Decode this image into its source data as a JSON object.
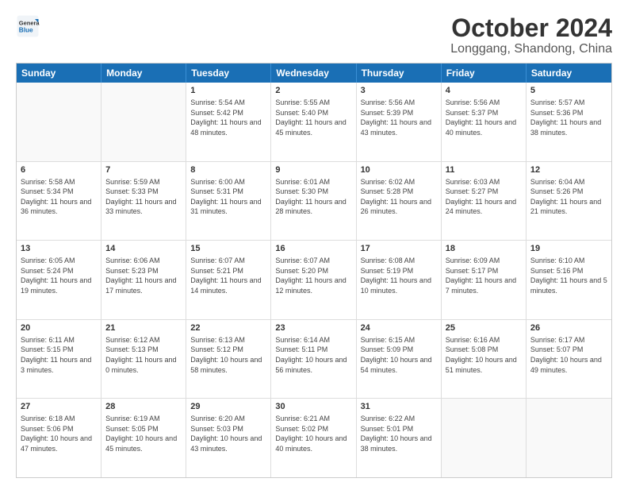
{
  "logo": {
    "line1": "General",
    "line2": "Blue"
  },
  "header": {
    "month": "October 2024",
    "location": "Longgang, Shandong, China"
  },
  "days_of_week": [
    "Sunday",
    "Monday",
    "Tuesday",
    "Wednesday",
    "Thursday",
    "Friday",
    "Saturday"
  ],
  "weeks": [
    [
      {
        "day": "",
        "info": ""
      },
      {
        "day": "",
        "info": ""
      },
      {
        "day": "1",
        "info": "Sunrise: 5:54 AM\nSunset: 5:42 PM\nDaylight: 11 hours and 48 minutes."
      },
      {
        "day": "2",
        "info": "Sunrise: 5:55 AM\nSunset: 5:40 PM\nDaylight: 11 hours and 45 minutes."
      },
      {
        "day": "3",
        "info": "Sunrise: 5:56 AM\nSunset: 5:39 PM\nDaylight: 11 hours and 43 minutes."
      },
      {
        "day": "4",
        "info": "Sunrise: 5:56 AM\nSunset: 5:37 PM\nDaylight: 11 hours and 40 minutes."
      },
      {
        "day": "5",
        "info": "Sunrise: 5:57 AM\nSunset: 5:36 PM\nDaylight: 11 hours and 38 minutes."
      }
    ],
    [
      {
        "day": "6",
        "info": "Sunrise: 5:58 AM\nSunset: 5:34 PM\nDaylight: 11 hours and 36 minutes."
      },
      {
        "day": "7",
        "info": "Sunrise: 5:59 AM\nSunset: 5:33 PM\nDaylight: 11 hours and 33 minutes."
      },
      {
        "day": "8",
        "info": "Sunrise: 6:00 AM\nSunset: 5:31 PM\nDaylight: 11 hours and 31 minutes."
      },
      {
        "day": "9",
        "info": "Sunrise: 6:01 AM\nSunset: 5:30 PM\nDaylight: 11 hours and 28 minutes."
      },
      {
        "day": "10",
        "info": "Sunrise: 6:02 AM\nSunset: 5:28 PM\nDaylight: 11 hours and 26 minutes."
      },
      {
        "day": "11",
        "info": "Sunrise: 6:03 AM\nSunset: 5:27 PM\nDaylight: 11 hours and 24 minutes."
      },
      {
        "day": "12",
        "info": "Sunrise: 6:04 AM\nSunset: 5:26 PM\nDaylight: 11 hours and 21 minutes."
      }
    ],
    [
      {
        "day": "13",
        "info": "Sunrise: 6:05 AM\nSunset: 5:24 PM\nDaylight: 11 hours and 19 minutes."
      },
      {
        "day": "14",
        "info": "Sunrise: 6:06 AM\nSunset: 5:23 PM\nDaylight: 11 hours and 17 minutes."
      },
      {
        "day": "15",
        "info": "Sunrise: 6:07 AM\nSunset: 5:21 PM\nDaylight: 11 hours and 14 minutes."
      },
      {
        "day": "16",
        "info": "Sunrise: 6:07 AM\nSunset: 5:20 PM\nDaylight: 11 hours and 12 minutes."
      },
      {
        "day": "17",
        "info": "Sunrise: 6:08 AM\nSunset: 5:19 PM\nDaylight: 11 hours and 10 minutes."
      },
      {
        "day": "18",
        "info": "Sunrise: 6:09 AM\nSunset: 5:17 PM\nDaylight: 11 hours and 7 minutes."
      },
      {
        "day": "19",
        "info": "Sunrise: 6:10 AM\nSunset: 5:16 PM\nDaylight: 11 hours and 5 minutes."
      }
    ],
    [
      {
        "day": "20",
        "info": "Sunrise: 6:11 AM\nSunset: 5:15 PM\nDaylight: 11 hours and 3 minutes."
      },
      {
        "day": "21",
        "info": "Sunrise: 6:12 AM\nSunset: 5:13 PM\nDaylight: 11 hours and 0 minutes."
      },
      {
        "day": "22",
        "info": "Sunrise: 6:13 AM\nSunset: 5:12 PM\nDaylight: 10 hours and 58 minutes."
      },
      {
        "day": "23",
        "info": "Sunrise: 6:14 AM\nSunset: 5:11 PM\nDaylight: 10 hours and 56 minutes."
      },
      {
        "day": "24",
        "info": "Sunrise: 6:15 AM\nSunset: 5:09 PM\nDaylight: 10 hours and 54 minutes."
      },
      {
        "day": "25",
        "info": "Sunrise: 6:16 AM\nSunset: 5:08 PM\nDaylight: 10 hours and 51 minutes."
      },
      {
        "day": "26",
        "info": "Sunrise: 6:17 AM\nSunset: 5:07 PM\nDaylight: 10 hours and 49 minutes."
      }
    ],
    [
      {
        "day": "27",
        "info": "Sunrise: 6:18 AM\nSunset: 5:06 PM\nDaylight: 10 hours and 47 minutes."
      },
      {
        "day": "28",
        "info": "Sunrise: 6:19 AM\nSunset: 5:05 PM\nDaylight: 10 hours and 45 minutes."
      },
      {
        "day": "29",
        "info": "Sunrise: 6:20 AM\nSunset: 5:03 PM\nDaylight: 10 hours and 43 minutes."
      },
      {
        "day": "30",
        "info": "Sunrise: 6:21 AM\nSunset: 5:02 PM\nDaylight: 10 hours and 40 minutes."
      },
      {
        "day": "31",
        "info": "Sunrise: 6:22 AM\nSunset: 5:01 PM\nDaylight: 10 hours and 38 minutes."
      },
      {
        "day": "",
        "info": ""
      },
      {
        "day": "",
        "info": ""
      }
    ]
  ]
}
